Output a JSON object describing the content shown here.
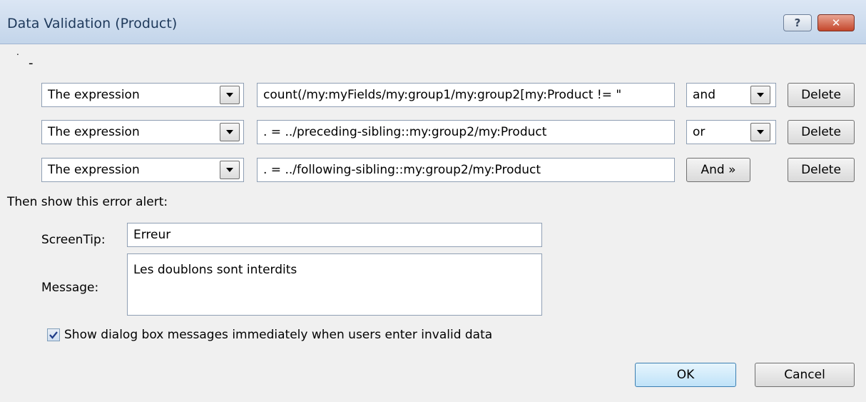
{
  "window": {
    "title": "Data Validation (Product)",
    "help_label": "?",
    "close_label": "✕"
  },
  "misc": {
    "dot": ".",
    "dash": "-"
  },
  "conditions": [
    {
      "type": "The expression",
      "expression": "count(/my:myFields/my:group1/my:group2[my:Product != \"",
      "operator": "and"
    },
    {
      "type": "The expression",
      "expression": ". = ../preceding-sibling::my:group2/my:Product",
      "operator": "or"
    },
    {
      "type": "The expression",
      "expression": ". = ../following-sibling::my:group2/my:Product",
      "operator": "And »"
    }
  ],
  "delete_label": "Delete",
  "error_alert": {
    "heading": "Then show this error alert:",
    "screentip_label": "ScreenTip:",
    "screentip_value": "Erreur",
    "message_label": "Message:",
    "message_value": "Les doublons sont interdits"
  },
  "immediate": {
    "checked": true,
    "label": "Show dialog box messages immediately when users enter invalid data"
  },
  "footer": {
    "ok_label": "OK",
    "cancel_label": "Cancel"
  }
}
